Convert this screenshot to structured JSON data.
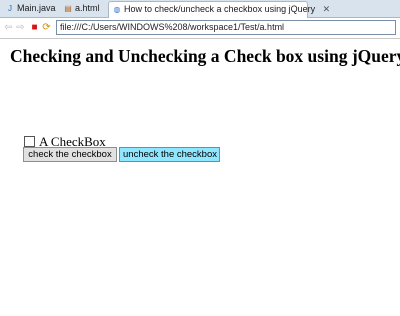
{
  "tabs": [
    {
      "label": "Main.java",
      "icon": "java-file-icon"
    },
    {
      "label": "a.html",
      "icon": "html-file-icon"
    },
    {
      "label": "How to check/uncheck a checkbox using jQuery",
      "icon": "web-browser-icon",
      "close": "✕"
    }
  ],
  "nav": {
    "back": "⇦",
    "forward": "⇨",
    "stop": "■",
    "refresh": "⟳",
    "address": "file:///C:/Users/WINDOWS%208/workspace1/Test/a.html"
  },
  "page": {
    "heading": "Checking and Unchecking a Check box using jQuery",
    "checkbox_label": "A CheckBox",
    "checkbox_checked": false,
    "check_button": "check the checkbox",
    "uncheck_button": "uncheck the checkbox"
  },
  "colors": {
    "tab_bar": "#d9e3ee",
    "uncheck_button_bg": "#8fe6ff"
  }
}
